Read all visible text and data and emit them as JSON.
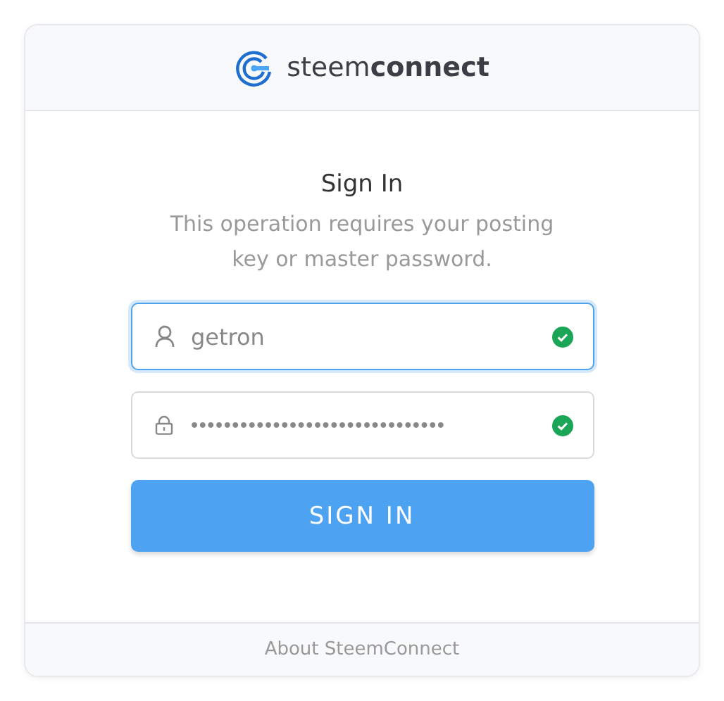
{
  "header": {
    "logo_text": "steem**connect**"
  },
  "title": "Sign In",
  "message": "This operation requires your posting key or master password.",
  "fields": [
    {
      "kind": "username",
      "value": "getron",
      "focused": true,
      "valid": true
    },
    {
      "kind": "password",
      "value": "•••••••••••••••••••••••••••••••",
      "focused": false,
      "valid": true
    }
  ],
  "submit": {
    "label": "SIGN IN"
  },
  "footer": {
    "link": "About SteemConnect"
  }
}
